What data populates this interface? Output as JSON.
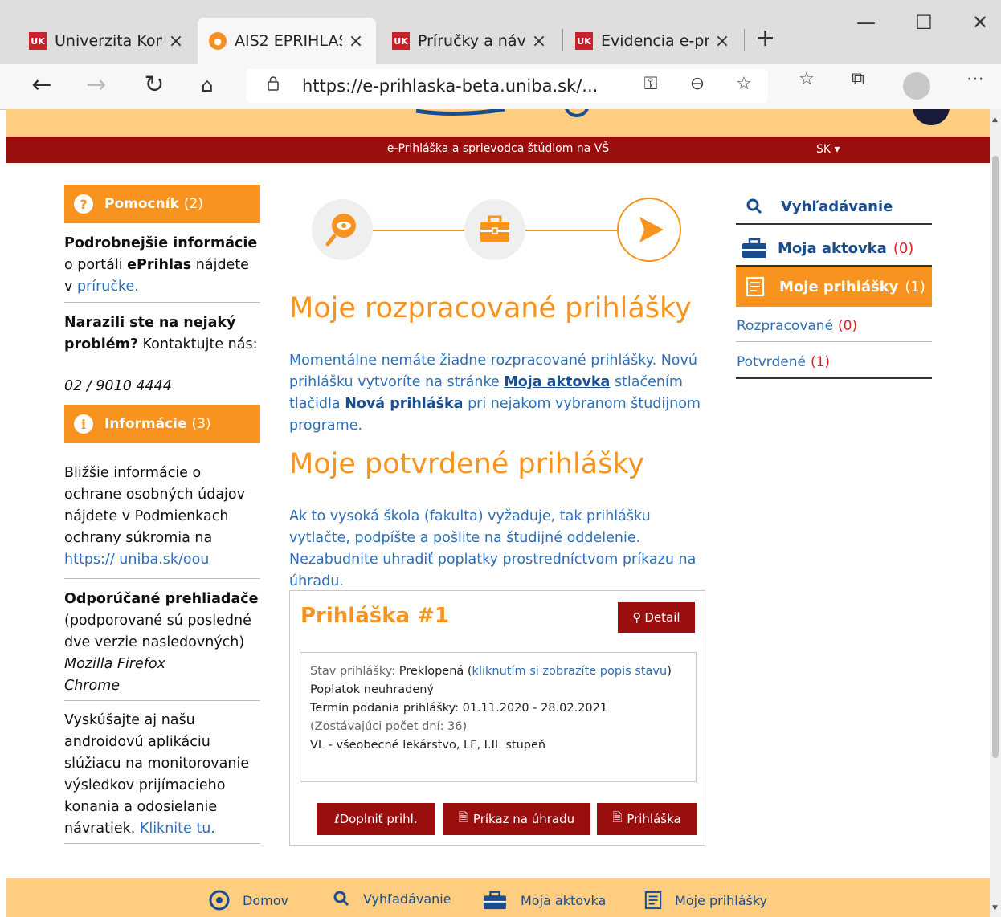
{
  "browser": {
    "tabs": [
      {
        "label": "Univerzita Kom",
        "favicon": "uk-logo"
      },
      {
        "label": "AIS2 EPRIHLAS",
        "favicon": "ais-logo"
      },
      {
        "label": "Príručky a návo",
        "favicon": "uk-logo"
      },
      {
        "label": "Evidencia e-pri",
        "favicon": "uk-logo"
      }
    ],
    "url": "https://e-prihlaska-beta.uniba.sk/..."
  },
  "site": {
    "header_title": "e-Prihláška a sprievodca štúdiom na VŠ",
    "language": "SK"
  },
  "left": {
    "helper": {
      "title": "Pomocník",
      "count": "(2)"
    },
    "info_bold": "Podrobnejšie informácie",
    "info_text1": "o portáli",
    "info_brand": "ePrihlas",
    "info_text2": "nájdete v",
    "info_link": "príručke.",
    "problem_bold": "Narazili ste na nejaký problém?",
    "problem_text": "Kontaktujte nás:",
    "phone": "02 / 9010 4444",
    "information": {
      "title": "Informácie",
      "count": "(3)"
    },
    "privacy_text": "Bližšie informácie o ochrane osobných údajov nájdete v Podmienkach ochrany súkromia na",
    "privacy_link": "https:// uniba.sk/oou",
    "browsers_bold": "Odporúčané prehliadače",
    "browsers_text": "(podporované sú posledné dve verzie nasledovných)",
    "browser1": "Mozilla Firefox",
    "browser2": "Chrome",
    "app_text": "Vyskúšajte aj našu androidovú aplikáciu slúžiacu na monitorovanie výsledkov prijímacieho konania a odosielanie návratiek.",
    "app_link": "Kliknite tu."
  },
  "main": {
    "heading1": "Moje rozpracované prihlášky",
    "para1_a": "Momentálne nemáte žiadne rozpracované prihlášky. Novú prihlášku vytvoríte na stránke",
    "para1_link": "Moja aktovka",
    "para1_b": "stlačením tlačidla",
    "para1_bold": "Nová prihláška",
    "para1_c": "pri nejakom vybranom študijnom programe.",
    "heading2": "Moje potvrdené prihlášky",
    "para2": "Ak to vysoká škola (fakulta) vyžaduje, tak prihlášku vytlačte, podpíšte a pošlite na študijné oddelenie. Nezabudnite uhradiť poplatky prostredníctvom príkazu na úhradu.",
    "card": {
      "title": "Prihláška #1",
      "detail_button": "Detail",
      "status_label": "Stav prihlášky:",
      "status_value": "Preklopená (",
      "status_link": "kliknutím si zobrazíte popis stavu",
      "status_close": ")",
      "fee": "Poplatok neuhradený",
      "deadline": "Termín podania prihlášky: 01.11.2020 - 28.02.2021",
      "remaining": "(Zostávajúci počet dní: 36)",
      "program": "VL - všeobecné lekárstvo, LF, I.II. stupeň",
      "btn_complete": "Doplniť prihl.",
      "btn_payment": "Príkaz na úhradu",
      "btn_application": "Prihláška"
    }
  },
  "right": {
    "search": "Vyhľadávanie",
    "briefcase": "Moja aktovka",
    "briefcase_count": "(0)",
    "applications": "Moje prihlášky",
    "applications_count": "(1)",
    "in_progress": "Rozpracované",
    "in_progress_count": "(0)",
    "confirmed": "Potvrdené",
    "confirmed_count": "(1)"
  },
  "footer": {
    "home": "Domov",
    "search": "Vyhľadávanie",
    "briefcase": "Moja aktovka",
    "applications": "Moje prihlášky"
  },
  "colors": {
    "accent": "#f7931e",
    "brand_red": "#9b0e0e",
    "link": "#2e6fb7",
    "band": "#fecd80"
  }
}
